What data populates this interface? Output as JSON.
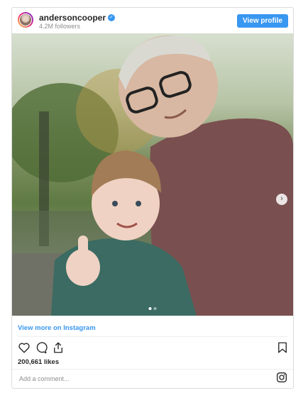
{
  "header": {
    "username": "andersoncooper",
    "followers": "4.2M followers",
    "view_profile_label": "View profile"
  },
  "post": {
    "carousel_dots": 2,
    "active_dot": 1
  },
  "footer": {
    "view_more_label": "View more on Instagram",
    "likes": "200,661 likes",
    "comment_placeholder": "Add a comment..."
  },
  "icons": {
    "verified": "verified-badge-icon",
    "like": "heart-icon",
    "comment": "comment-icon",
    "share": "share-icon",
    "save": "bookmark-icon",
    "next": "chevron-right-icon",
    "instagram": "instagram-icon"
  },
  "colors": {
    "accent": "#3897f0",
    "text": "#262626",
    "muted": "#8e8e8e",
    "border": "#dbdbdb"
  }
}
